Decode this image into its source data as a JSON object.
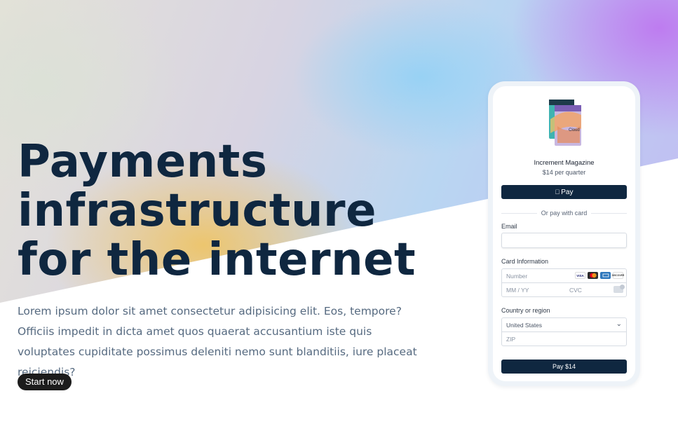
{
  "hero": {
    "headline_lines": [
      "Payments",
      "infrastructure",
      "for the internet"
    ],
    "lede": "Lorem ipsum dolor sit amet consectetur adipisicing elit. Eos, tempore? Officiis impedit in dicta amet quos quaerat accusantium iste quis voluptates cupiditate possimus deleniti nemo sunt blanditiis, iure placeat reiciendis?",
    "cta_label": "Start now"
  },
  "checkout": {
    "product_name": "Increment Magazine",
    "product_price": "$14 per quarter",
    "product_image_labels": [
      "Cloud"
    ],
    "apple_pay_label": "Pay",
    "apple_pay_icon": "apple-icon",
    "divider_text": "Or pay with card",
    "email_label": "Email",
    "email_value": "",
    "card_label": "Card Information",
    "card_number_placeholder": "Number",
    "card_expiry_placeholder": "MM / YY",
    "card_cvc_placeholder": "CVC",
    "card_brands": [
      "VISA",
      "mastercard",
      "amex",
      "DISCOVER"
    ],
    "country_label": "Country or region",
    "country_value": "United States",
    "zip_placeholder": "ZIP",
    "pay_button_label": "Pay $14"
  },
  "colors": {
    "navy": "#0f2740",
    "body_text": "#566a80",
    "cta_bg": "#1c1c1c"
  }
}
